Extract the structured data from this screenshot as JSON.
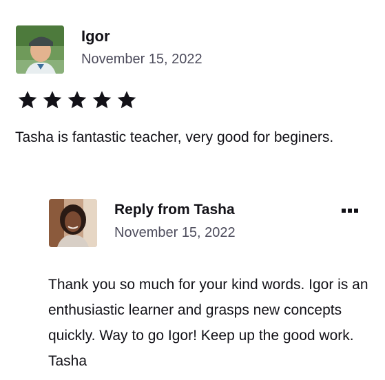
{
  "review": {
    "reviewer_name": "Igor",
    "date": "November 15, 2022",
    "rating": 5,
    "rating_max": 5,
    "text": "Tasha is fantastic teacher, very good for beginers."
  },
  "reply": {
    "title": "Reply from Tasha",
    "date": "November 15, 2022",
    "text": "Thank you so much for your kind words. Igor is an enthusiastic learner and grasps new concepts quickly. Way to go Igor! Keep up the good work. Tasha",
    "menu_icon": "more-horizontal-icon"
  },
  "colors": {
    "text": "#121117",
    "muted": "#4d4c5c",
    "star": "#121117"
  }
}
